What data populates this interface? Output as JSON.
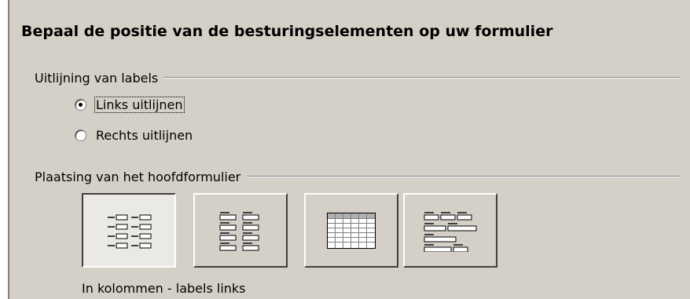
{
  "page": {
    "title": "Bepaal de positie van de besturingselementen op uw formulier"
  },
  "label_alignment": {
    "group_label": "Uitlijning van labels",
    "options": [
      {
        "label": "Links uitlijnen",
        "selected": true
      },
      {
        "label": "Rechts uitlijnen",
        "selected": false
      }
    ]
  },
  "main_form_placement": {
    "group_label": "Plaatsing van het hoofdformulier",
    "buttons": [
      {
        "icon": "columns-labels-left-icon",
        "pressed": true
      },
      {
        "icon": "columns-labels-top-icon",
        "pressed": false
      },
      {
        "icon": "datasheet-table-icon",
        "pressed": false
      },
      {
        "icon": "blocks-labels-top-icon",
        "pressed": false
      }
    ],
    "selected_caption": "In kolommen - labels links"
  }
}
